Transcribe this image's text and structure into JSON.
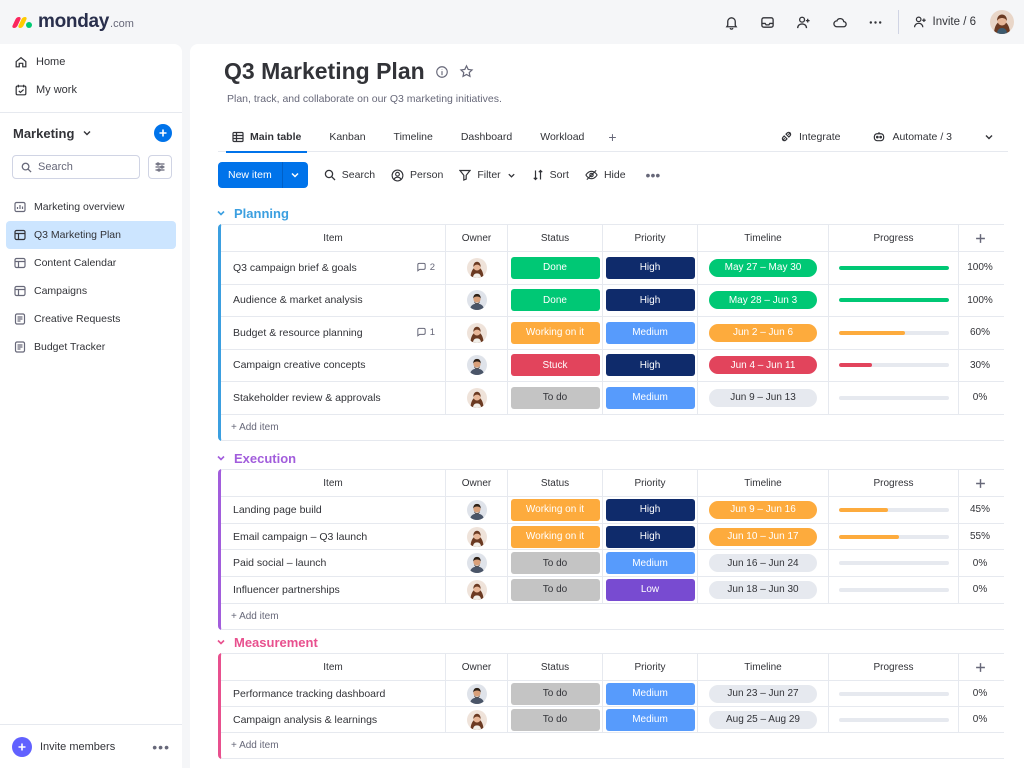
{
  "topbar": {
    "logo_text": "monday",
    "logo_suffix": ".com",
    "logo_colors": [
      "#fb275d",
      "#ffcb00",
      "#00ca72"
    ],
    "icons": [
      "bell-icon",
      "inbox-icon",
      "invite-user-icon",
      "apps-icon",
      "more-icon"
    ],
    "invite_label": "Invite / 6"
  },
  "sidebar": {
    "top_items": [
      {
        "label": "Home",
        "icon": "home-icon"
      },
      {
        "label": "My work",
        "icon": "my-work-icon"
      }
    ],
    "workspace_name": "Marketing",
    "search_placeholder": "Search",
    "boards": [
      {
        "label": "Marketing overview",
        "active": false
      },
      {
        "label": "Q3 Marketing Plan",
        "active": true
      },
      {
        "label": "Content Calendar",
        "active": false
      },
      {
        "label": "Campaigns",
        "active": false
      },
      {
        "label": "Creative Requests",
        "active": false
      },
      {
        "label": "Budget Tracker",
        "active": false
      }
    ],
    "invite_members_label": "Invite members"
  },
  "board": {
    "title": "Q3 Marketing Plan",
    "description": "Plan, track, and collaborate on our Q3 marketing initiatives.",
    "tabs": [
      {
        "label": "Main table",
        "active": true
      },
      {
        "label": "Kanban",
        "active": false
      },
      {
        "label": "Timeline",
        "active": false
      },
      {
        "label": "Dashboard",
        "active": false
      },
      {
        "label": "Workload",
        "active": false
      }
    ],
    "integrate_label": "Integrate",
    "automate_label": "Automate / 3"
  },
  "toolbar": {
    "new_item_label": "New item",
    "search_label": "Search",
    "person_label": "Person",
    "filter_label": "Filter",
    "sort_label": "Sort",
    "hide_label": "Hide"
  },
  "columns": {
    "item": "Item",
    "owner": "Owner",
    "status": "Status",
    "priority": "Priority",
    "timeline": "Timeline",
    "progress": "Progress"
  },
  "colors": {
    "done": "#00c875",
    "working": "#fdab3d",
    "stuck": "#e2445c",
    "todo": "#c4c4c4",
    "high": "#0f2b6b",
    "medium": "#579bfc",
    "low": "#784bd1",
    "planning": "#579bfc",
    "execution": "#a25ddc",
    "measurement": "#ff5ac4"
  },
  "groups": [
    {
      "title": "Planning",
      "color": "#3b9fe0",
      "add_item_label": "+ Add item",
      "rows": [
        {
          "item": "Q3 campaign brief & goals",
          "updates": "2",
          "owner": "f",
          "status": "Done",
          "status_kind": "done",
          "priority": "High",
          "priority_kind": "high",
          "timeline": "May 27 – May 30",
          "timeline_kind": "done",
          "progress": 100,
          "progress_label": "100%",
          "progress_kind": "done"
        },
        {
          "item": "Audience & market analysis",
          "updates": "",
          "owner": "m",
          "status": "Done",
          "status_kind": "done",
          "priority": "High",
          "priority_kind": "high",
          "timeline": "May 28 – Jun 3",
          "timeline_kind": "done",
          "progress": 100,
          "progress_label": "100%",
          "progress_kind": "done"
        },
        {
          "item": "Budget & resource planning",
          "updates": "1",
          "owner": "f",
          "status": "Working on it",
          "status_kind": "working",
          "priority": "Medium",
          "priority_kind": "medium",
          "timeline": "Jun 2 – Jun 6",
          "timeline_kind": "working",
          "progress": 60,
          "progress_label": "60%",
          "progress_kind": "working"
        },
        {
          "item": "Campaign creative concepts",
          "updates": "",
          "owner": "m",
          "status": "Stuck",
          "status_kind": "stuck",
          "priority": "High",
          "priority_kind": "high",
          "timeline": "Jun 4 – Jun 11",
          "timeline_kind": "stuck",
          "progress": 30,
          "progress_label": "30%",
          "progress_kind": "stuck"
        },
        {
          "item": "Stakeholder review & approvals",
          "updates": "",
          "owner": "f",
          "status": "To do",
          "status_kind": "todo",
          "priority": "Medium",
          "priority_kind": "medium",
          "timeline": "Jun 9 – Jun 13",
          "timeline_kind": "todo",
          "progress": 0,
          "progress_label": "0%",
          "progress_kind": "todo"
        }
      ]
    },
    {
      "title": "Execution",
      "color": "#a25ddc",
      "add_item_label": "+ Add item",
      "rows": [
        {
          "item": "Landing page build",
          "updates": "",
          "owner": "m",
          "status": "Working on it",
          "status_kind": "working",
          "priority": "High",
          "priority_kind": "high",
          "timeline": "Jun 9 – Jun 16",
          "timeline_kind": "working",
          "progress": 45,
          "progress_label": "45%",
          "progress_kind": "working"
        },
        {
          "item": "Email campaign – Q3 launch",
          "updates": "",
          "owner": "f",
          "status": "Working on it",
          "status_kind": "working",
          "priority": "High",
          "priority_kind": "high",
          "timeline": "Jun 10 – Jun 17",
          "timeline_kind": "working",
          "progress": 55,
          "progress_label": "55%",
          "progress_kind": "working"
        },
        {
          "item": "Paid social – launch",
          "updates": "",
          "owner": "m",
          "status": "To do",
          "status_kind": "todo",
          "priority": "Medium",
          "priority_kind": "medium",
          "timeline": "Jun 16 – Jun 24",
          "timeline_kind": "todo",
          "progress": 0,
          "progress_label": "0%",
          "progress_kind": "todo"
        },
        {
          "item": "Influencer partnerships",
          "updates": "",
          "owner": "f",
          "status": "To do",
          "status_kind": "todo",
          "priority": "Low",
          "priority_kind": "low",
          "timeline": "Jun 18 – Jun 30",
          "timeline_kind": "todo",
          "progress": 0,
          "progress_label": "0%",
          "progress_kind": "todo"
        }
      ]
    },
    {
      "title": "Measurement",
      "color": "#e8508e",
      "add_item_label": "+ Add item",
      "rows": [
        {
          "item": "Performance tracking dashboard",
          "updates": "",
          "owner": "m",
          "status": "To do",
          "status_kind": "todo",
          "priority": "Medium",
          "priority_kind": "medium",
          "timeline": "Jun 23 – Jun 27",
          "timeline_kind": "todo",
          "progress": 0,
          "progress_label": "0%",
          "progress_kind": "todo"
        },
        {
          "item": "Campaign analysis & learnings",
          "updates": "",
          "owner": "f",
          "status": "To do",
          "status_kind": "todo",
          "priority": "Medium",
          "priority_kind": "medium",
          "timeline": "Aug 25 – Aug 29",
          "timeline_kind": "todo",
          "progress": 0,
          "progress_label": "0%",
          "progress_kind": "todo"
        }
      ]
    }
  ]
}
